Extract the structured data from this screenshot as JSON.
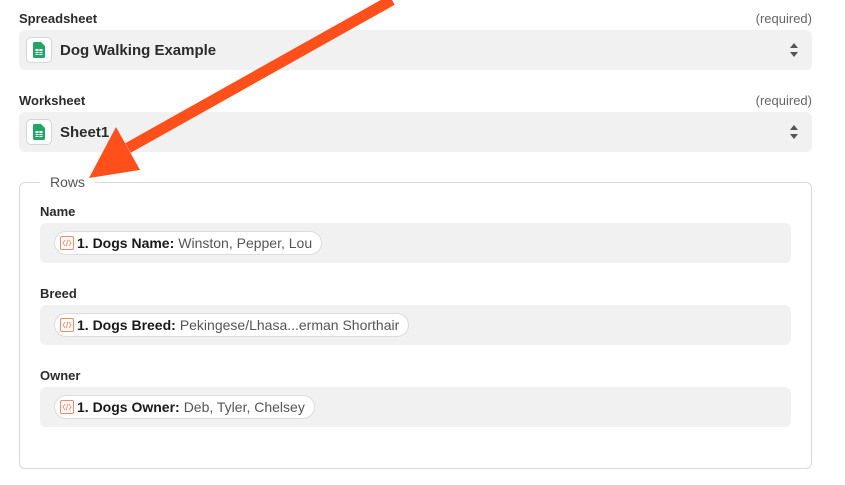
{
  "spreadsheet": {
    "label": "Spreadsheet",
    "required": "(required)",
    "value": "Dog Walking Example"
  },
  "worksheet": {
    "label": "Worksheet",
    "required": "(required)",
    "value": "Sheet1"
  },
  "rows": {
    "legend": "Rows",
    "fields": [
      {
        "label": "Name",
        "pill_key": "1. Dogs Name:",
        "pill_value": "Winston, Pepper, Lou"
      },
      {
        "label": "Breed",
        "pill_key": "1. Dogs Breed:",
        "pill_value": "Pekingese/Lhasa...erman Shorthair"
      },
      {
        "label": "Owner",
        "pill_key": "1. Dogs Owner:",
        "pill_value": "Deb, Tyler, Chelsey"
      }
    ]
  },
  "icons": {
    "sheet_icon": "google-sheets-icon",
    "selector_icon": "up-down-chevron-icon",
    "pill_icon": "code-icon",
    "annotation": "arrow-icon"
  },
  "colors": {
    "accent_arrow": "#ff4f1a",
    "sheets_green": "#23a566",
    "code_icon": "#f08a6a"
  }
}
